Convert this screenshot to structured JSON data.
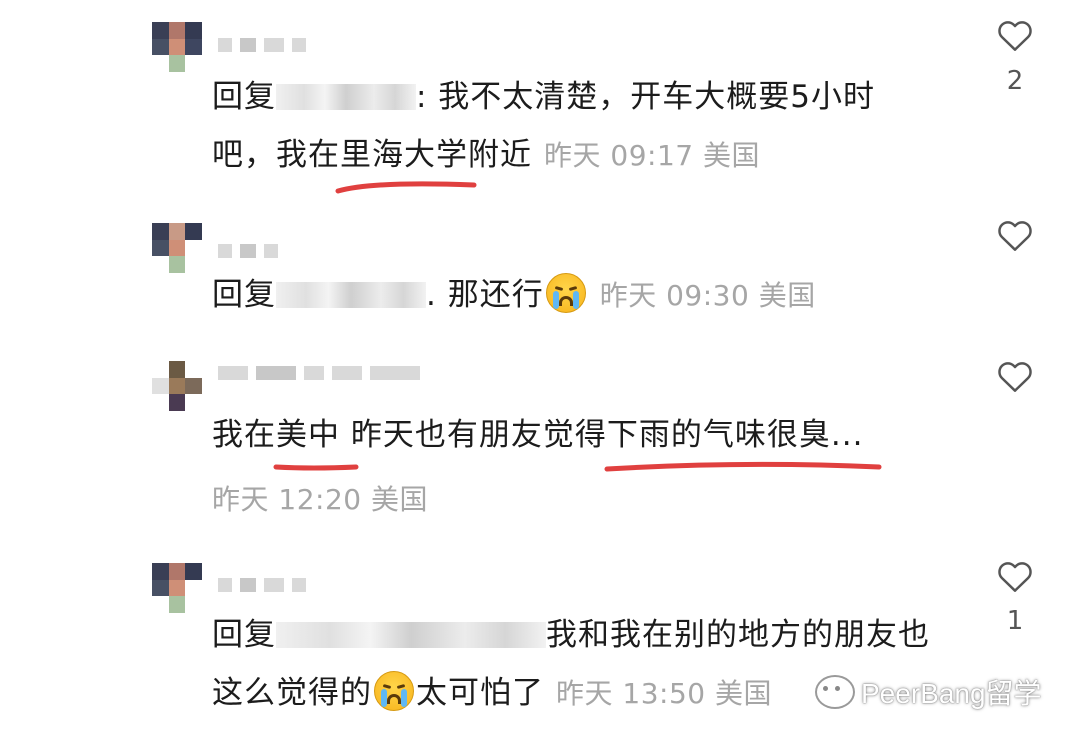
{
  "comments": [
    {
      "prefix": "回复",
      "text_before": ": 我不太清楚，开车大概要5小时吧，我在",
      "highlight": "里海大学",
      "text_after": "附近",
      "time": "昨天 09:17",
      "location": "美国",
      "likes": "2"
    },
    {
      "prefix": "回复",
      "text_before": ". 那还行",
      "time": "昨天 09:30",
      "location": "美国",
      "likes": ""
    },
    {
      "text_before": "我在",
      "highlight1": "美中",
      "text_mid": " 昨天也有朋友觉得",
      "highlight2": "下雨的气味很臭",
      "text_after": "...",
      "time": "昨天 12:20",
      "location": "美国",
      "likes": ""
    },
    {
      "prefix": "回复",
      "text_before": "我和我在别的地方的朋友也这么觉得的",
      "text_after": "太可怕了",
      "time": "昨天 13:50",
      "location": "美国",
      "likes": "1"
    }
  ],
  "icons": {
    "like": "heart-outline-icon",
    "emoji": "crying-face-emoji-icon",
    "watermark": "wechat-icon"
  },
  "colors": {
    "text": "#1c1c1c",
    "meta": "#a6a6a6",
    "underline": "#e0403f"
  },
  "watermark": {
    "text": "PeerBang留学"
  }
}
